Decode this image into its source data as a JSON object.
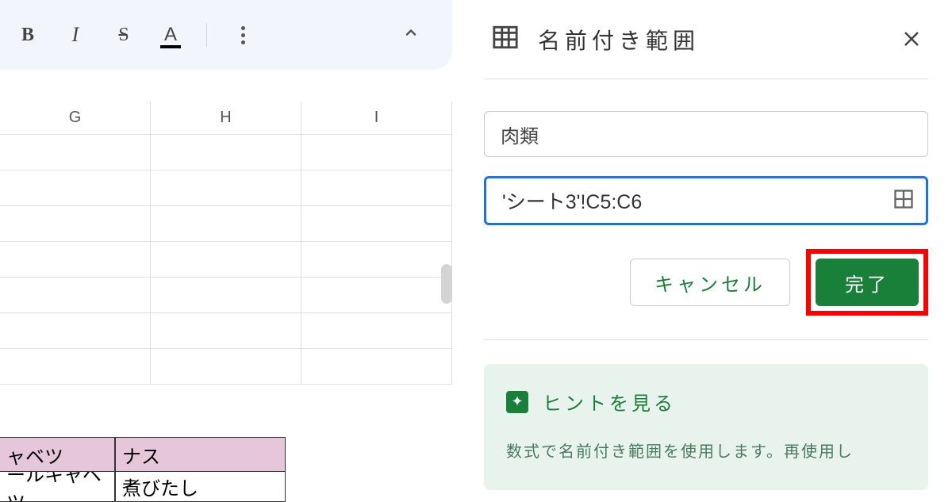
{
  "toolbar": {
    "bold_label": "B",
    "italic_label": "I",
    "strike_label": "S",
    "textcolor_label": "A"
  },
  "columns": [
    "G",
    "H",
    "I"
  ],
  "data_cells": {
    "r1a": "ャベツ",
    "r1b": "ナス",
    "r2a": "ールキャベツ",
    "r2b": "煮びたし"
  },
  "panel": {
    "title": "名前付き範囲",
    "name_value": "肉類",
    "range_value": "'シート3'!C5:C6",
    "cancel_label": "キャンセル",
    "done_label": "完了"
  },
  "hint": {
    "title": "ヒントを見る",
    "body": "数式で名前付き範囲を使用します。再使用し"
  }
}
